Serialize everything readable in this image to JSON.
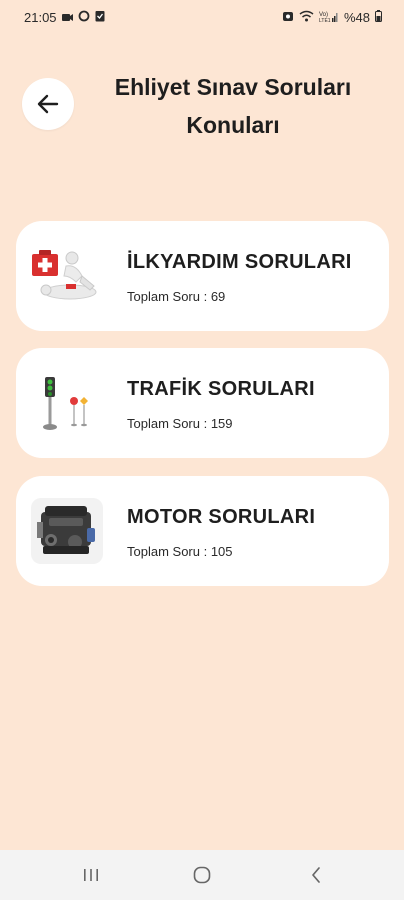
{
  "status_bar": {
    "time": "21:05",
    "battery": "%48",
    "signal_text": "Vo) LTE1"
  },
  "header": {
    "title": "Ehliyet Sınav Soruları Konuları",
    "back_icon": "arrow-left-icon"
  },
  "categories": [
    {
      "title": "İLKYARDIM SORULARI",
      "count": "Toplam Soru : 69",
      "icon": "first-aid-icon"
    },
    {
      "title": "TRAFİK SORULARI",
      "count": "Toplam Soru : 159",
      "icon": "traffic-light-icon"
    },
    {
      "title": "MOTOR SORULARI",
      "count": "Toplam Soru : 105",
      "icon": "engine-icon"
    }
  ],
  "colors": {
    "background": "#fde6d4",
    "card": "#ffffff",
    "text": "#1e1e1e"
  }
}
